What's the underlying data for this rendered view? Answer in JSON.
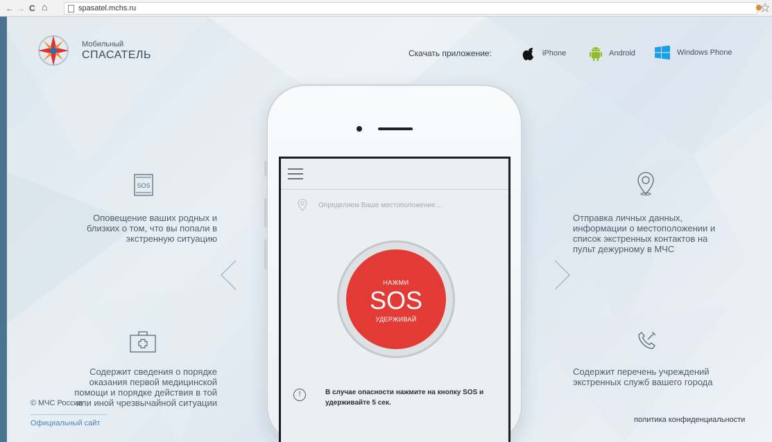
{
  "browser": {
    "back": "←",
    "forward": "→",
    "reload": "C",
    "home": "⌂",
    "url": "spasatel.mchs.ru"
  },
  "header": {
    "logo_line1": "Мобильный",
    "logo_line2": "СПАСАТЕЛЬ",
    "download_label": "Скачать приложение:",
    "stores": [
      {
        "label": "iPhone",
        "icon": "apple-icon"
      },
      {
        "label": "Android",
        "icon": "android-icon"
      },
      {
        "label": "Windows Phone",
        "icon": "windows-icon"
      }
    ]
  },
  "features": {
    "top_left": "Оповещение ваших родных и\nблизких о том, что вы попали в\nэкстренную ситуацию",
    "top_left_icon_text": "SOS",
    "bottom_left": "Содержит сведения о порядке\nоказания первой медицинской\nпомощи и порядке действия в той\nили иной чрезвычайной ситуации",
    "top_right": "Отправка личных данных,\nинформации о местоположении и\nсписок экстренных контактов на\nпульт дежурному в МЧС",
    "bottom_right": "Содержит перечень учреждений\nэкстренных служб вашего города"
  },
  "app": {
    "location_text": "Определяем Ваше местоположение...",
    "sos_top": "НАЖМИ",
    "sos_main": "SOS",
    "sos_bottom": "УДЕРЖИВАЙ",
    "info_icon": "!",
    "info_text": "В случае опасности нажмите на кнопку SOS и удерживайте 5 сек."
  },
  "footer": {
    "copyright": "© МЧС России",
    "official_link": "Официальный сайт",
    "privacy": "политика конфиденциальности"
  },
  "colors": {
    "sos_red": "#e23b36",
    "link_blue": "#4a84c0",
    "logo_red": "#e0322c"
  }
}
